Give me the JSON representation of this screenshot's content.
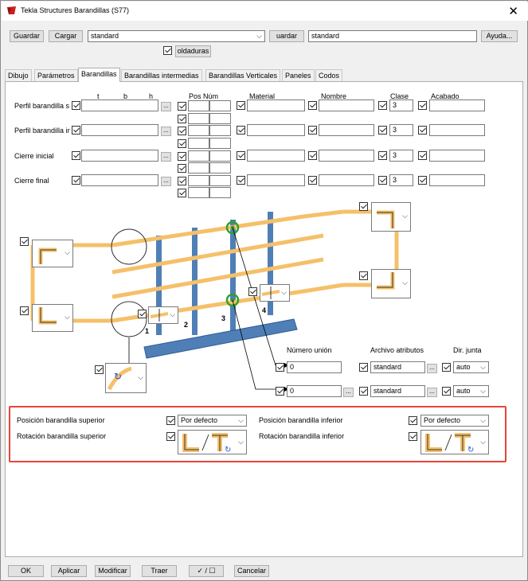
{
  "window": {
    "title": "Tekla Structures  Barandillas (S77)"
  },
  "toolbar": {
    "save": "Guardar",
    "load": "Cargar",
    "preset_value": "standard",
    "save_as": "uardar con",
    "save_as_value": "standard",
    "help": "Ayuda...",
    "welds": "oldaduras"
  },
  "tabs": [
    "Dibujo",
    "Parámetros",
    "Barandillas",
    "Barandillas intermedias",
    "Barandillas Verticales",
    "Paneles",
    "Codos"
  ],
  "headers": {
    "t": "t",
    "b": "b",
    "h": "h",
    "pos_num": "Pos Núm",
    "material": "Material",
    "nombre": "Nombre",
    "clase": "Clase",
    "acabado": "Acabado"
  },
  "rows": [
    {
      "label": "Perfil barandilla s",
      "clase": "3"
    },
    {
      "label": "Perfil barandilla in",
      "clase": "3"
    },
    {
      "label": "Cierre inicial",
      "clase": "3"
    },
    {
      "label": "Cierre final",
      "clase": "3"
    }
  ],
  "dots_label": "...",
  "diagram": {
    "numbers": [
      "1",
      "2",
      "3",
      "4"
    ],
    "numero_union": "Número unión",
    "archivo_atributos": "Archivo atributos",
    "dir_junta": "Dir. junta",
    "union1": {
      "num": "0",
      "attr": "standard",
      "dir": "auto"
    },
    "union2": {
      "num": "0",
      "attr": "standard",
      "dir": "auto"
    }
  },
  "position": {
    "pos_sup_label": "Posición barandilla superior",
    "rot_sup_label": "Rotación barandilla superior",
    "pos_inf_label": "Posición barandilla inferior",
    "rot_inf_label": "Rotación barandilla inferior",
    "pos_sup_value": "Por defecto",
    "pos_inf_value": "Por defecto"
  },
  "footer": {
    "ok": "OK",
    "apply": "Aplicar",
    "modify": "Modificar",
    "get": "Traer",
    "toggle": "✓ / ☐",
    "cancel": "Cancelar"
  },
  "colors": {
    "rail": "#f5c06a",
    "post": "#4f7fb6",
    "highlight": "#e8443a",
    "joint": "#33a02c"
  }
}
